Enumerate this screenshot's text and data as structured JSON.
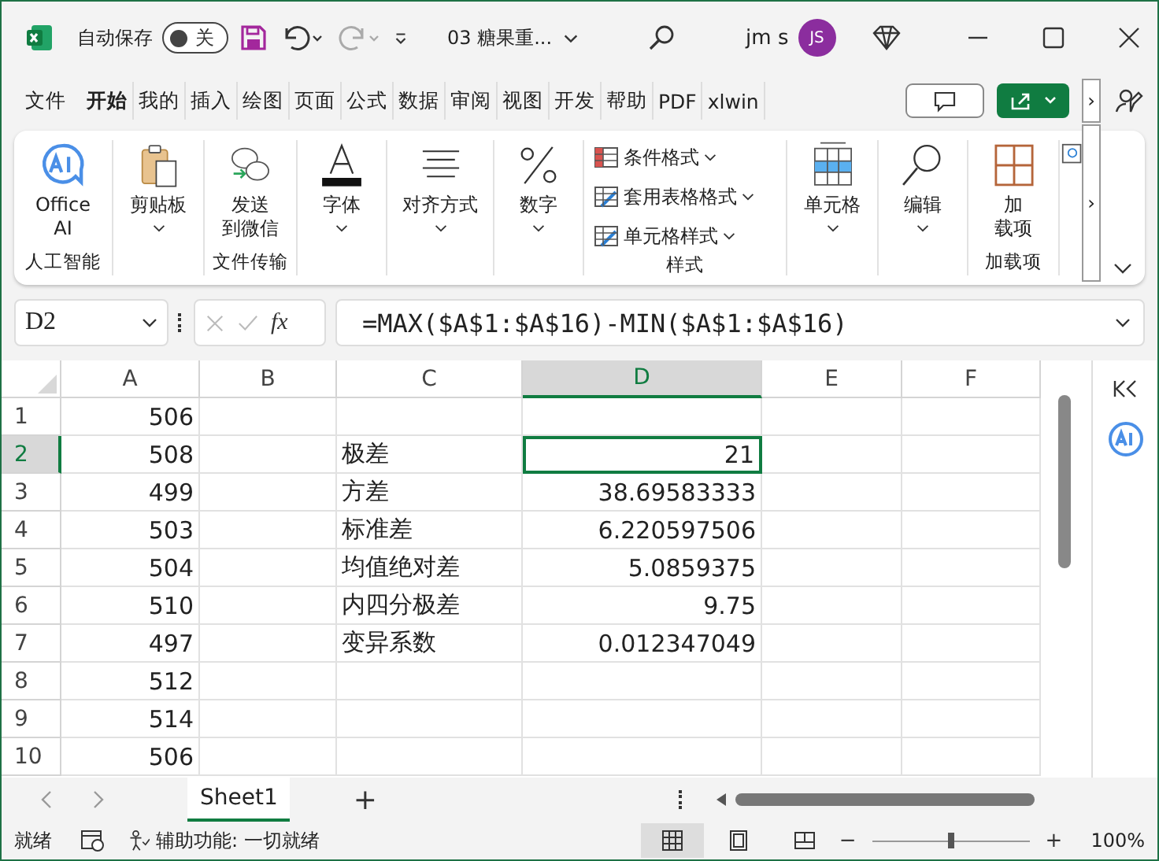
{
  "title_bar": {
    "autosave_label": "自动保存",
    "autosave_toggle": {
      "on": false,
      "label": "关"
    },
    "file_name": "03 糖果重...",
    "user_name": "jm s",
    "avatar_initials": "JS"
  },
  "menu_tabs": [
    {
      "label": "文件",
      "selected": false
    },
    {
      "label": "开始",
      "selected": true
    },
    {
      "label": "我的",
      "selected": false
    },
    {
      "label": "插入",
      "selected": false
    },
    {
      "label": "绘图",
      "selected": false
    },
    {
      "label": "页面",
      "selected": false
    },
    {
      "label": "公式",
      "selected": false
    },
    {
      "label": "数据",
      "selected": false
    },
    {
      "label": "审阅",
      "selected": false
    },
    {
      "label": "视图",
      "selected": false
    },
    {
      "label": "开发",
      "selected": false
    },
    {
      "label": "帮助",
      "selected": false
    },
    {
      "label": "PDF",
      "selected": false
    },
    {
      "label": "xlwin",
      "selected": false
    }
  ],
  "ribbon": {
    "more_label": "›",
    "groups": [
      {
        "label": "人工智能",
        "items": [
          {
            "kind": "large",
            "label": [
              "Office",
              "AI"
            ],
            "dropdown": false
          }
        ]
      },
      {
        "items": [
          {
            "kind": "large",
            "label": [
              "剪贴板"
            ],
            "dropdown": true
          }
        ]
      },
      {
        "label": "文件传输",
        "items": [
          {
            "kind": "large",
            "label": [
              "发送",
              "到微信"
            ],
            "dropdown": false
          }
        ]
      },
      {
        "items": [
          {
            "kind": "large",
            "label": [
              "字体"
            ],
            "dropdown": true
          }
        ]
      },
      {
        "items": [
          {
            "kind": "large",
            "label": [
              "对齐方式"
            ],
            "dropdown": true
          }
        ]
      },
      {
        "items": [
          {
            "kind": "large",
            "label": [
              "数字"
            ],
            "dropdown": true
          }
        ]
      },
      {
        "label": "样式",
        "items": [
          {
            "kind": "small",
            "label": [
              "条件格式"
            ],
            "dropdown": true
          },
          {
            "kind": "small",
            "label": [
              "套用表格格式"
            ],
            "dropdown": true
          },
          {
            "kind": "small",
            "label": [
              "单元格样式"
            ],
            "dropdown": true
          }
        ]
      },
      {
        "items": [
          {
            "kind": "large",
            "label": [
              "单元格"
            ],
            "dropdown": true
          }
        ]
      },
      {
        "items": [
          {
            "kind": "large",
            "label": [
              "编辑"
            ],
            "dropdown": true
          }
        ]
      },
      {
        "label": "加载项",
        "items": [
          {
            "kind": "large",
            "label": [
              "加",
              "载项"
            ],
            "dropdown": false
          }
        ]
      }
    ]
  },
  "formula_bar": {
    "name_box": "D2",
    "fx_label": "fx",
    "formula": "=MAX($A$1:$A$16)-MIN($A$1:$A$16)"
  },
  "sheet": {
    "columns": [
      {
        "label": "A",
        "selected": false
      },
      {
        "label": "B",
        "selected": false
      },
      {
        "label": "C",
        "selected": false
      },
      {
        "label": "D",
        "selected": true
      },
      {
        "label": "E",
        "selected": false
      },
      {
        "label": "F",
        "selected": false
      }
    ],
    "rows": [
      {
        "row": "1",
        "selected": false,
        "cells": {
          "A": "506"
        }
      },
      {
        "row": "2",
        "selected": true,
        "cells": {
          "A": "508",
          "C": "极差",
          "D": "21"
        }
      },
      {
        "row": "3",
        "selected": false,
        "cells": {
          "A": "499",
          "C": "方差",
          "D": "38.69583333"
        }
      },
      {
        "row": "4",
        "selected": false,
        "cells": {
          "A": "503",
          "C": "标准差",
          "D": "6.220597506"
        }
      },
      {
        "row": "5",
        "selected": false,
        "cells": {
          "A": "504",
          "C": "均值绝对差",
          "D": "5.0859375"
        }
      },
      {
        "row": "6",
        "selected": false,
        "cells": {
          "A": "510",
          "C": "内四分极差",
          "D": "9.75"
        }
      },
      {
        "row": "7",
        "selected": false,
        "cells": {
          "A": "497",
          "C": "变异系数",
          "D": "0.012347049"
        }
      },
      {
        "row": "8",
        "selected": false,
        "cells": {
          "A": "512"
        }
      },
      {
        "row": "9",
        "selected": false,
        "cells": {
          "A": "514"
        }
      },
      {
        "row": "10",
        "selected": false,
        "cells": {
          "A": "506"
        }
      }
    ]
  },
  "sheet_tabs": [
    {
      "label": "Sheet1",
      "selected": true
    }
  ],
  "add_sheet_label": "+",
  "status_bar": {
    "status": "就绪",
    "accessibility": "辅助功能: 一切就绪",
    "views": [
      {
        "kind": "normal",
        "selected": true
      },
      {
        "kind": "layout",
        "selected": false
      },
      {
        "kind": "pagebreak",
        "selected": false
      }
    ],
    "zoom_minus": "−",
    "zoom_plus": "+",
    "zoom": {
      "level": 0.5
    },
    "zoom_label": "100%"
  }
}
